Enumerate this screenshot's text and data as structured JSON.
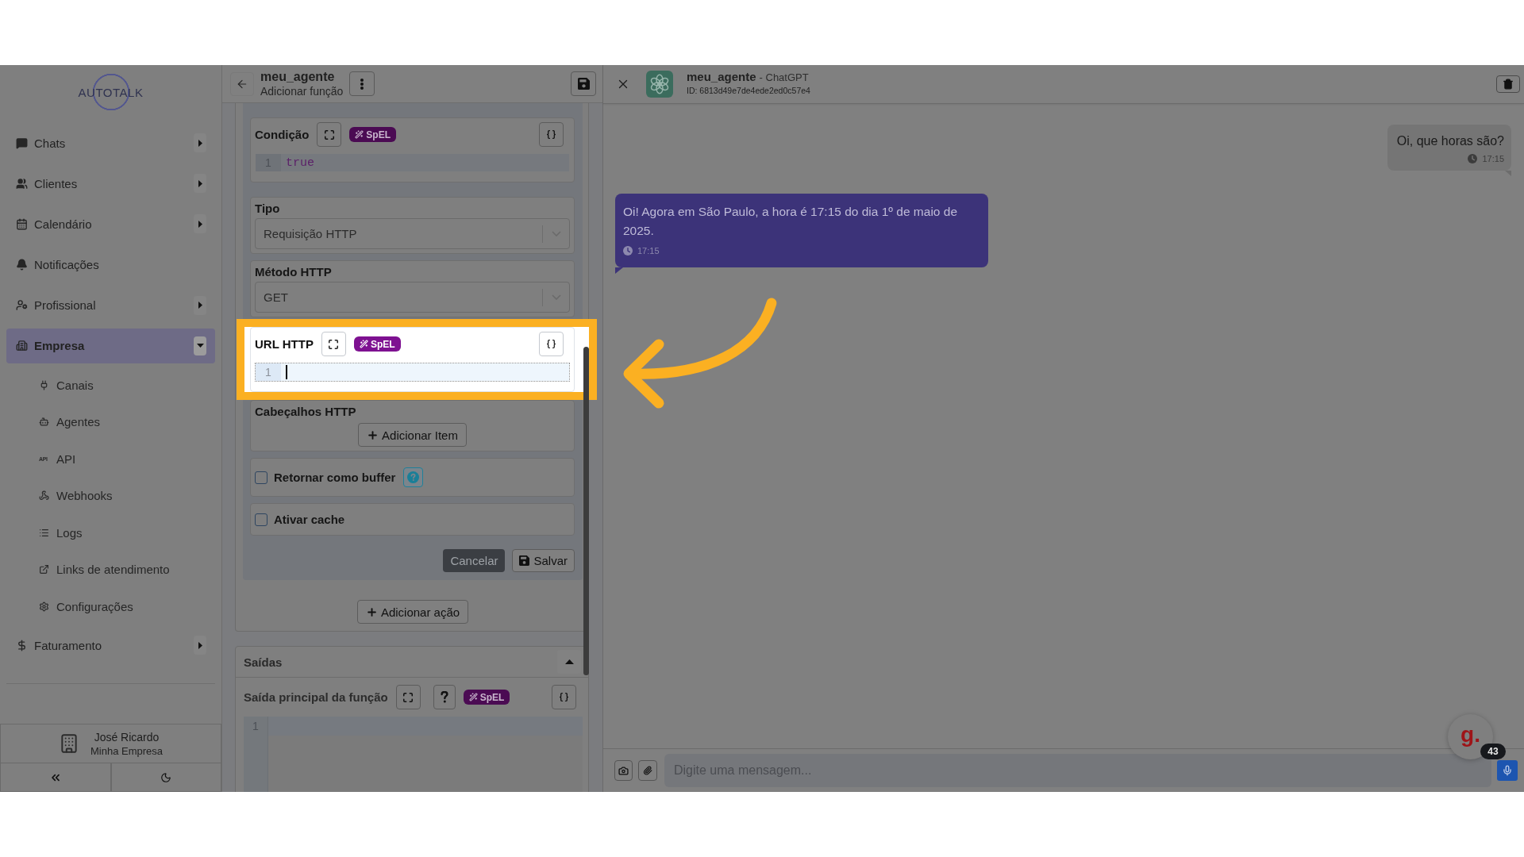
{
  "sidebar": {
    "logo": "AUTOTALK",
    "items": [
      {
        "label": "Chats",
        "expandable": true,
        "expanded": false,
        "selected": false
      },
      {
        "label": "Clientes",
        "expandable": true,
        "expanded": false,
        "selected": false
      },
      {
        "label": "Calendário",
        "expandable": true,
        "expanded": false,
        "selected": false
      },
      {
        "label": "Notificações",
        "expandable": false,
        "selected": false
      },
      {
        "label": "Profissional",
        "expandable": true,
        "expanded": false,
        "selected": false
      },
      {
        "label": "Empresa",
        "expandable": true,
        "expanded": true,
        "selected": true,
        "children": [
          {
            "label": "Canais",
            "selected": false
          },
          {
            "label": "Agentes",
            "selected": false
          },
          {
            "label": "API",
            "glyph": "API",
            "selected": false
          },
          {
            "label": "Webhooks",
            "selected": false
          },
          {
            "label": "Logs",
            "selected": false
          },
          {
            "label": "Links de atendimento",
            "selected": false
          },
          {
            "label": "Configurações",
            "selected": false
          }
        ]
      },
      {
        "label": "Faturamento",
        "expandable": true,
        "expanded": false,
        "selected": false
      }
    ],
    "user": {
      "name": "José Ricardo",
      "company": "Minha Empresa"
    }
  },
  "editor": {
    "title": "meu_agente",
    "subtitle": "Adicionar função",
    "fields": [
      {
        "kind": "code",
        "label": "Condição",
        "badge": "SpEL",
        "line_number": "1",
        "code": "true",
        "focused": false,
        "highlighted": false
      },
      {
        "kind": "select",
        "label": "Tipo",
        "value": "Requisição HTTP"
      },
      {
        "kind": "select",
        "label": "Método HTTP",
        "value": "GET"
      },
      {
        "kind": "code",
        "label": "URL HTTP",
        "badge": "SpEL",
        "line_number": "1",
        "focused": true,
        "highlighted": true
      },
      {
        "kind": "list",
        "label": "Cabeçalhos HTTP",
        "button": "Adicionar Item"
      },
      {
        "kind": "checkbox",
        "label": "Retornar como buffer",
        "checked": false,
        "help": true
      },
      {
        "kind": "checkbox",
        "label": "Ativar cache",
        "checked": false
      }
    ],
    "buttons": [
      {
        "kind": "cancel",
        "label": "Cancelar"
      },
      {
        "kind": "save",
        "label": "Salvar"
      }
    ],
    "add_action": "Adicionar ação",
    "outputs": {
      "title": "Saídas",
      "expanded": true,
      "label": "Saída principal da função",
      "badge": "SpEL",
      "line_number": "1"
    }
  },
  "chat": {
    "title": "meu_agente",
    "provider": "- ChatGPT",
    "id": "ID: 6813d49e7de4ede2ed0c57e4",
    "messages": [
      {
        "kind": "sent",
        "text": "Oi, que horas são?",
        "time": "17:15"
      },
      {
        "kind": "received",
        "text": "Oi! Agora em São Paulo, a hora é 17:15 do dia 1º de maio de 2025.",
        "time": "17:15"
      }
    ],
    "input": {
      "placeholder": "Digite uma mensagem..."
    },
    "widget": {
      "logo": "g.",
      "badge": "43"
    }
  }
}
